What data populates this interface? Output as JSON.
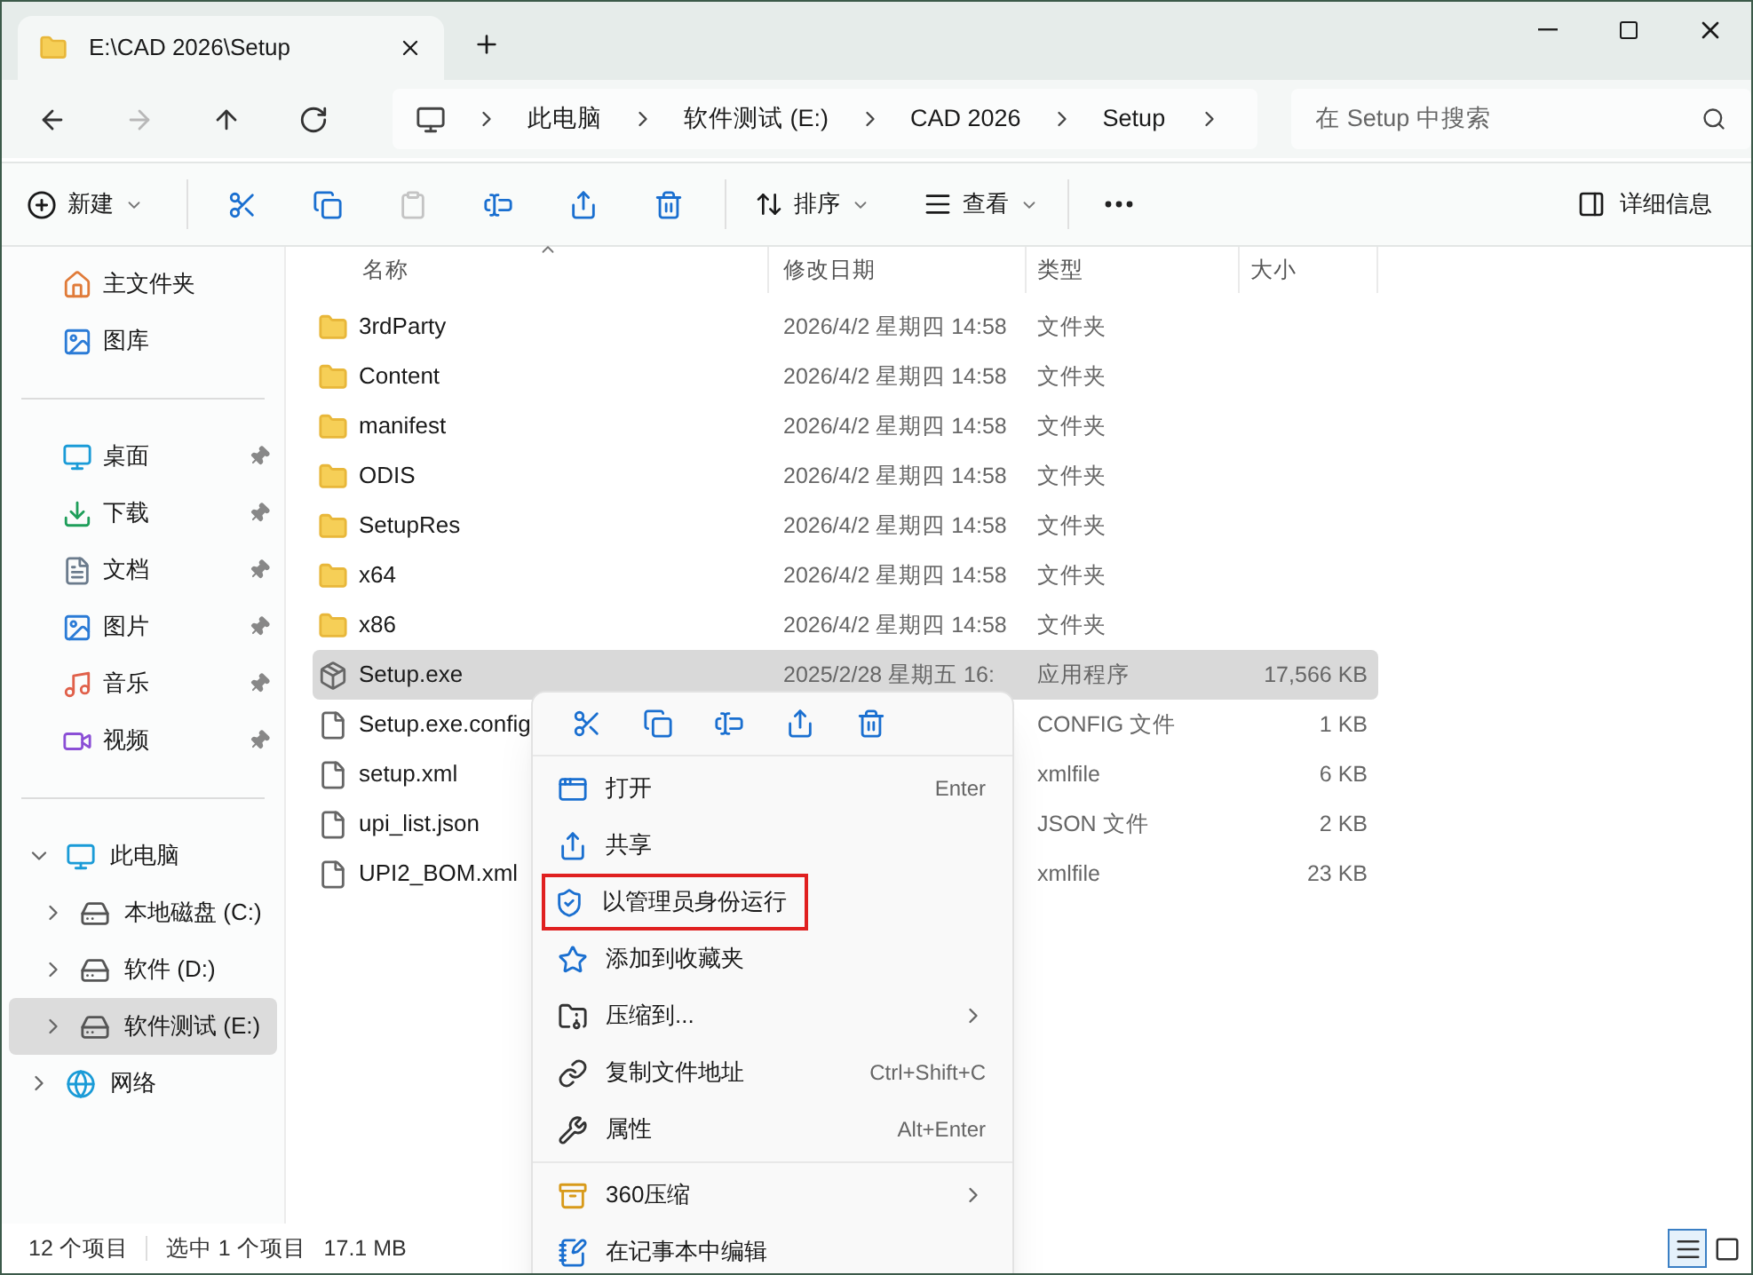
{
  "window": {
    "tab_title": "E:\\CAD 2026\\Setup"
  },
  "nav": [
    {
      "kind": "back",
      "disabled": false
    },
    {
      "kind": "forward",
      "disabled": true
    },
    {
      "kind": "up",
      "disabled": false
    },
    {
      "kind": "refresh",
      "disabled": false
    }
  ],
  "breadcrumb": [
    "此电脑",
    "软件测试 (E:)",
    "CAD 2026",
    "Setup"
  ],
  "search": {
    "placeholder": "在 Setup 中搜索"
  },
  "toolbar": {
    "new": "新建",
    "icon_buttons": [
      {
        "kind": "cut",
        "disabled": false
      },
      {
        "kind": "copy",
        "disabled": false
      },
      {
        "kind": "paste",
        "disabled": true
      },
      {
        "kind": "rename",
        "disabled": false
      },
      {
        "kind": "share",
        "disabled": false
      },
      {
        "kind": "delete",
        "disabled": false
      }
    ],
    "sort": "排序",
    "view": "查看",
    "details": "详细信息"
  },
  "sidebar": {
    "quick": [
      {
        "label": "主文件夹"
      },
      {
        "label": "图库"
      }
    ],
    "pinned": [
      {
        "label": "桌面",
        "pinned": true
      },
      {
        "label": "下载",
        "pinned": true
      },
      {
        "label": "文档",
        "pinned": true
      },
      {
        "label": "图片",
        "pinned": true
      },
      {
        "label": "音乐",
        "pinned": true
      },
      {
        "label": "视频",
        "pinned": true
      }
    ],
    "tree": [
      {
        "label": "此电脑",
        "kind": "computer",
        "expanded": true,
        "selected": false,
        "children": [
          {
            "label": "本地磁盘 (C:)",
            "kind": "drive",
            "expanded": false,
            "selected": false
          },
          {
            "label": "软件 (D:)",
            "kind": "drive",
            "expanded": false,
            "selected": false
          },
          {
            "label": "软件测试 (E:)",
            "kind": "drive",
            "expanded": false,
            "selected": true
          }
        ]
      },
      {
        "label": "网络",
        "kind": "network",
        "expanded": false,
        "selected": false
      }
    ]
  },
  "table": {
    "columns": [
      "名称",
      "修改日期",
      "类型",
      "大小"
    ],
    "rows": [
      {
        "kind": "folder",
        "name": "3rdParty",
        "date": "2026/4/2 星期四 14:58",
        "type": "文件夹",
        "selected": false
      },
      {
        "kind": "folder",
        "name": "Content",
        "date": "2026/4/2 星期四 14:58",
        "type": "文件夹",
        "selected": false
      },
      {
        "kind": "folder",
        "name": "manifest",
        "date": "2026/4/2 星期四 14:58",
        "type": "文件夹",
        "selected": false
      },
      {
        "kind": "folder",
        "name": "ODIS",
        "date": "2026/4/2 星期四 14:58",
        "type": "文件夹",
        "selected": false
      },
      {
        "kind": "folder",
        "name": "SetupRes",
        "date": "2026/4/2 星期四 14:58",
        "type": "文件夹",
        "selected": false
      },
      {
        "kind": "folder",
        "name": "x64",
        "date": "2026/4/2 星期四 14:58",
        "type": "文件夹",
        "selected": false
      },
      {
        "kind": "folder",
        "name": "x86",
        "date": "2026/4/2 星期四 14:58",
        "type": "文件夹",
        "selected": false
      },
      {
        "kind": "app",
        "name": "Setup.exe",
        "date": "2025/2/28 星期五 16:",
        "type": "应用程序",
        "size": "17,566 KB",
        "selected": true
      },
      {
        "kind": "file",
        "name": "Setup.exe.config",
        "type": "CONFIG 文件",
        "size": "1 KB",
        "selected": false
      },
      {
        "kind": "file",
        "name": "setup.xml",
        "type": "xmlfile",
        "size": "6 KB",
        "selected": false
      },
      {
        "kind": "file",
        "name": "upi_list.json",
        "type": "JSON 文件",
        "size": "2 KB",
        "selected": false
      },
      {
        "kind": "file",
        "name": "UPI2_BOM.xml",
        "type": "xmlfile",
        "size": "23 KB",
        "selected": false
      }
    ]
  },
  "context_menu": {
    "groups": [
      [
        {
          "label": "打开",
          "shortcut": "Enter",
          "submenu": false,
          "highlighted": false
        },
        {
          "label": "共享",
          "submenu": false,
          "highlighted": false
        },
        {
          "label": "以管理员身份运行",
          "submenu": false,
          "highlighted": true
        },
        {
          "label": "添加到收藏夹",
          "submenu": false,
          "highlighted": false
        },
        {
          "label": "压缩到...",
          "submenu": true,
          "highlighted": false
        },
        {
          "label": "复制文件地址",
          "shortcut": "Ctrl+Shift+C",
          "submenu": false,
          "highlighted": false
        },
        {
          "label": "属性",
          "shortcut": "Alt+Enter",
          "submenu": false,
          "highlighted": false
        }
      ],
      [
        {
          "label": "360压缩",
          "submenu": true,
          "highlighted": false
        },
        {
          "label": "在记事本中编辑",
          "submenu": false,
          "highlighted": false
        }
      ]
    ]
  },
  "status_bar": {
    "count": "12 个项目",
    "selection": "选中 1 个项目",
    "size": "17.1 MB",
    "views": [
      {
        "kind": "details",
        "selected": true
      },
      {
        "kind": "tiles",
        "selected": false
      }
    ]
  }
}
